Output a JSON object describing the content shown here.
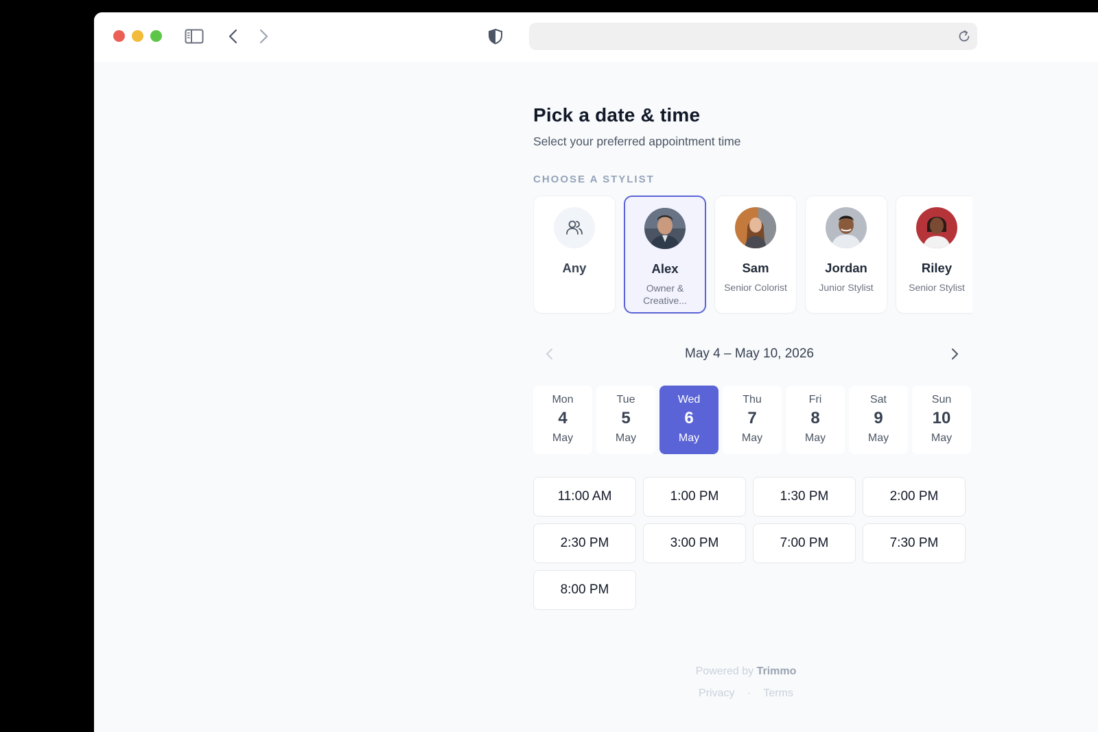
{
  "browser": {
    "url": "",
    "icons": {
      "sidebar": "sidebar-icon",
      "back": "chevron-left-icon",
      "forward": "chevron-right-icon",
      "shield": "shield-icon",
      "reload": "reload-icon"
    }
  },
  "page": {
    "title": "Pick a date & time",
    "subtitle": "Select your preferred appointment time"
  },
  "stylists": {
    "label": "CHOOSE A STYLIST",
    "items": [
      {
        "name": "Any",
        "role": "",
        "selected": false
      },
      {
        "name": "Alex",
        "role": "Owner & Creative...",
        "selected": true
      },
      {
        "name": "Sam",
        "role": "Senior Colorist",
        "selected": false
      },
      {
        "name": "Jordan",
        "role": "Junior Stylist",
        "selected": false
      },
      {
        "name": "Riley",
        "role": "Senior Stylist",
        "selected": false
      }
    ]
  },
  "week": {
    "label": "May 4 – May 10, 2026",
    "days": [
      {
        "name": "Mon",
        "num": "4",
        "month": "May",
        "selected": false
      },
      {
        "name": "Tue",
        "num": "5",
        "month": "May",
        "selected": false
      },
      {
        "name": "Wed",
        "num": "6",
        "month": "May",
        "selected": true
      },
      {
        "name": "Thu",
        "num": "7",
        "month": "May",
        "selected": false
      },
      {
        "name": "Fri",
        "num": "8",
        "month": "May",
        "selected": false
      },
      {
        "name": "Sat",
        "num": "9",
        "month": "May",
        "selected": false
      },
      {
        "name": "Sun",
        "num": "10",
        "month": "May",
        "selected": false
      }
    ]
  },
  "times": [
    "11:00 AM",
    "1:00 PM",
    "1:30 PM",
    "2:00 PM",
    "2:30 PM",
    "3:00 PM",
    "7:00 PM",
    "7:30 PM",
    "8:00 PM"
  ],
  "footer": {
    "powered_prefix": "Powered by",
    "brand": "Trimmo",
    "privacy": "Privacy",
    "separator": "·",
    "terms": "Terms"
  },
  "colors": {
    "accent": "#5b64d6",
    "accent_soft": "#f3f3fe",
    "page_bg": "#f8fafc"
  }
}
